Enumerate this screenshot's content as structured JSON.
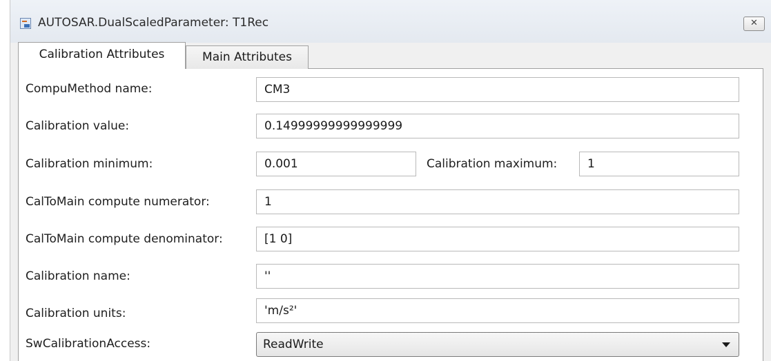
{
  "window": {
    "title": "AUTOSAR.DualScaledParameter: T1Rec",
    "close_glyph": "✕"
  },
  "tabs": [
    {
      "label": "Calibration Attributes",
      "active": true
    },
    {
      "label": "Main Attributes",
      "active": false
    }
  ],
  "form": {
    "compumethod_name": {
      "label": "CompuMethod name:",
      "value": "CM3"
    },
    "calibration_value": {
      "label": "Calibration value:",
      "value": "0.14999999999999999"
    },
    "calibration_minimum": {
      "label": "Calibration minimum:",
      "value": "0.001"
    },
    "calibration_maximum": {
      "label": "Calibration maximum:",
      "value": "1"
    },
    "caltomain_numerator": {
      "label": "CalToMain compute numerator:",
      "value": "1"
    },
    "caltomain_denominator": {
      "label": "CalToMain compute denominator:",
      "value": "[1 0]"
    },
    "calibration_name": {
      "label": "Calibration name:",
      "value": "''"
    },
    "calibration_units": {
      "label": "Calibration units:",
      "value": "'m/s²'"
    },
    "sw_calibration_access": {
      "label": "SwCalibrationAccess:",
      "value": "ReadWrite"
    }
  },
  "icons": {
    "window_icon": "simulink-model-icon",
    "close_icon": "close-icon",
    "dropdown_icon": "chevron-down-icon"
  }
}
